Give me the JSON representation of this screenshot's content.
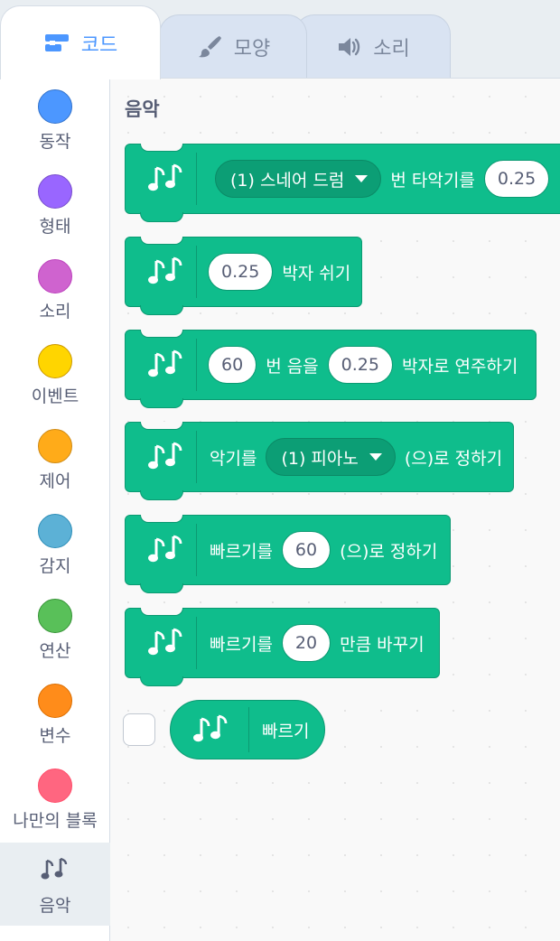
{
  "tabs": [
    {
      "label": "코드",
      "icon": "code-icon",
      "active": true
    },
    {
      "label": "모양",
      "icon": "brush-icon",
      "active": false
    },
    {
      "label": "소리",
      "icon": "speaker-icon",
      "active": false
    }
  ],
  "categories": [
    {
      "label": "동작",
      "color": "#4c97ff",
      "border": "#3373cc"
    },
    {
      "label": "형태",
      "color": "#9966ff",
      "border": "#774dcb"
    },
    {
      "label": "소리",
      "color": "#cf63cf",
      "border": "#bd42bd"
    },
    {
      "label": "이벤트",
      "color": "#ffd500",
      "border": "#cc9900"
    },
    {
      "label": "제어",
      "color": "#ffab19",
      "border": "#cf8b17"
    },
    {
      "label": "감지",
      "color": "#5cb1d6",
      "border": "#2e8eb8"
    },
    {
      "label": "연산",
      "color": "#59c059",
      "border": "#389438"
    },
    {
      "label": "변수",
      "color": "#ff8c1a",
      "border": "#db6e00"
    },
    {
      "label": "나만의 블록",
      "color": "#ff6680",
      "border": "#ff4d6a"
    },
    {
      "label": "음악",
      "icon": "music-icon",
      "selected": true
    }
  ],
  "palette": {
    "section_title": "음악",
    "blocks": {
      "play_drum": {
        "drum": "(1) 스네어 드럼",
        "text1": "번 타악기를",
        "beats": "0.25"
      },
      "rest": {
        "beats": "0.25",
        "text1": "박자 쉬기"
      },
      "play_note": {
        "note": "60",
        "text1": "번 음을",
        "beats": "0.25",
        "text2": "박자로 연주하기"
      },
      "set_instrument": {
        "text1": "악기를",
        "instrument": "(1) 피아노",
        "text2": "(으)로 정하기"
      },
      "set_tempo": {
        "text1": "빠르기를",
        "value": "60",
        "text2": "(으)로 정하기"
      },
      "change_tempo": {
        "text1": "빠르기를",
        "value": "20",
        "text2": "만큼 바꾸기"
      },
      "tempo_reporter": {
        "label": "빠르기"
      }
    }
  },
  "colors": {
    "accent": "#4c97ff",
    "music_block": "#0fbd8c",
    "music_block_border": "#0b9a72"
  }
}
